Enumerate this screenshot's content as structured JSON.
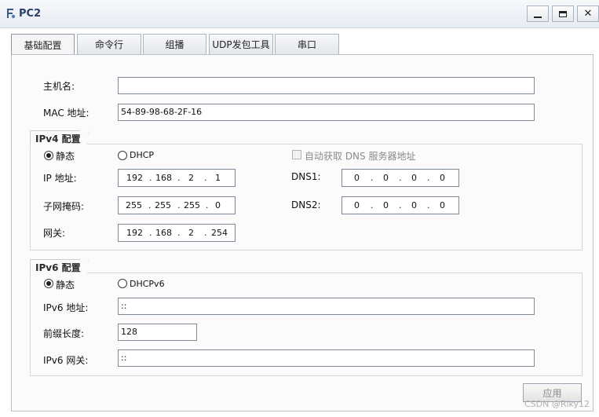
{
  "window": {
    "title": "PC2"
  },
  "tabs": [
    {
      "label": "基础配置",
      "active": true
    },
    {
      "label": "命令行"
    },
    {
      "label": "组播"
    },
    {
      "label": "UDP发包工具"
    },
    {
      "label": "串口"
    }
  ],
  "basic": {
    "hostname_label": "主机名:",
    "hostname_value": "",
    "mac_label": "MAC 地址:",
    "mac_value": "54-89-98-68-2F-16"
  },
  "ipv4": {
    "group_title": "IPv4 配置",
    "static_label": "静态",
    "dhcp_label": "DHCP",
    "auto_dns_label": "自动获取 DNS 服务器地址",
    "ip_label": "IP 地址:",
    "ip": [
      "192",
      "168",
      "2",
      "1"
    ],
    "mask_label": "子网掩码:",
    "mask": [
      "255",
      "255",
      "255",
      "0"
    ],
    "gateway_label": "网关:",
    "gateway": [
      "192",
      "168",
      "2",
      "254"
    ],
    "dns1_label": "DNS1:",
    "dns1": [
      "0",
      "0",
      "0",
      "0"
    ],
    "dns2_label": "DNS2:",
    "dns2": [
      "0",
      "0",
      "0",
      "0"
    ]
  },
  "ipv6": {
    "group_title": "IPv6 配置",
    "static_label": "静态",
    "dhcp_label": "DHCPv6",
    "addr_label": "IPv6 地址:",
    "addr_value": "::",
    "prefix_label": "前缀长度:",
    "prefix_value": "128",
    "gateway_label": "IPv6 网关:",
    "gateway_value": "::"
  },
  "buttons": {
    "apply": "应用"
  },
  "watermark": "CSDN @Riky12"
}
